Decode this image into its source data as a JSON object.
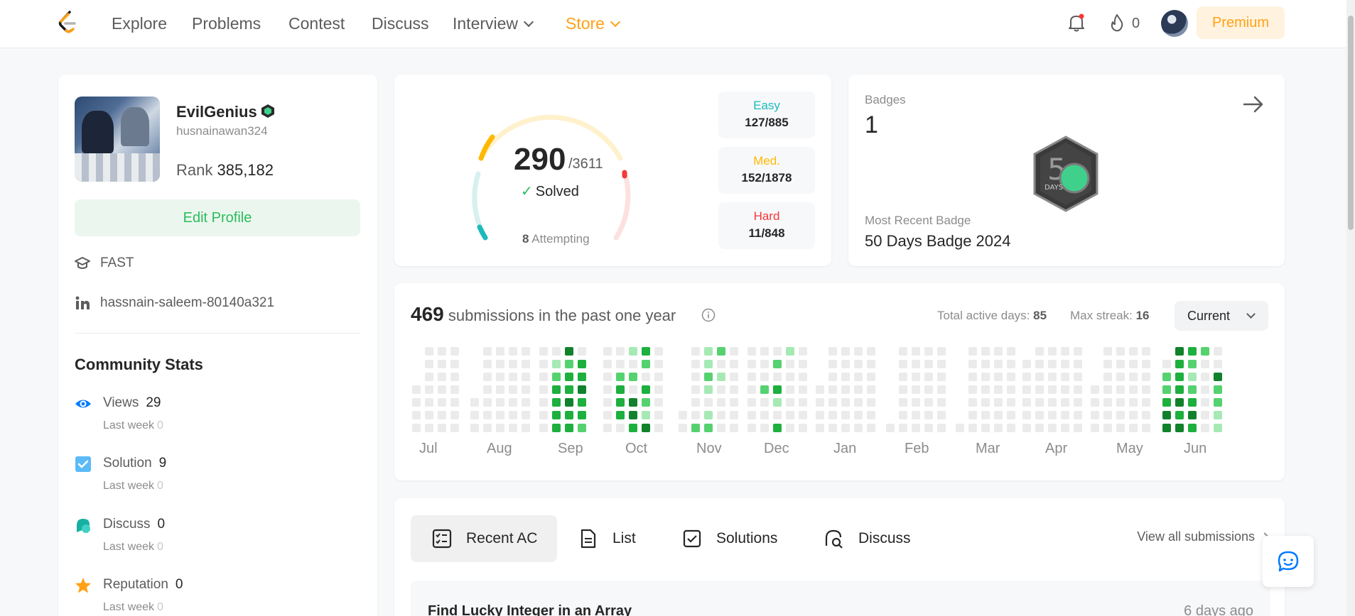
{
  "nav": {
    "items": [
      {
        "label": "Explore"
      },
      {
        "label": "Problems"
      },
      {
        "label": "Contest"
      },
      {
        "label": "Discuss"
      },
      {
        "label": "Interview"
      },
      {
        "label": "Store"
      }
    ],
    "streak": "0",
    "premium_label": "Premium",
    "store_color": "#ffa116"
  },
  "profile": {
    "display_name": "EvilGenius",
    "username": "husnainawan324",
    "rank_label": "Rank",
    "rank_value": "385,182",
    "edit_label": "Edit Profile",
    "school": "FAST",
    "linkedin": "hassnain-saleem-80140a321"
  },
  "community": {
    "title": "Community Stats",
    "stats": [
      {
        "label": "Views",
        "value": "29",
        "sub_label": "Last week",
        "sub_value": "0",
        "icon": "eye-icon"
      },
      {
        "label": "Solution",
        "value": "9",
        "sub_label": "Last week",
        "sub_value": "0",
        "icon": "checkbox-icon"
      },
      {
        "label": "Discuss",
        "value": "0",
        "sub_label": "Last week",
        "sub_value": "0",
        "icon": "chat-bubble-icon"
      },
      {
        "label": "Reputation",
        "value": "0",
        "sub_label": "Last week",
        "sub_value": "0",
        "icon": "star-icon"
      }
    ]
  },
  "solved": {
    "count": "290",
    "total": "/3611",
    "label": "Solved",
    "attempting_count": "8",
    "attempting_label": "Attempting",
    "easy": {
      "label": "Easy",
      "value": "127/885",
      "color": "#1cbaba"
    },
    "medium": {
      "label": "Med.",
      "value": "152/1878",
      "color": "#ffb800"
    },
    "hard": {
      "label": "Hard",
      "value": "11/848",
      "color": "#f63737"
    }
  },
  "badges": {
    "label": "Badges",
    "count": "1",
    "recent_label": "Most Recent Badge",
    "recent_name": "50 Days Badge 2024",
    "badge_text": "DAYS"
  },
  "submissions": {
    "count": "469",
    "label": "submissions in the past one year",
    "active_days_label": "Total active days:",
    "active_days": "85",
    "max_streak_label": "Max streak:",
    "max_streak": "16",
    "period": "Current",
    "months": [
      "Jul",
      "Aug",
      "Sep",
      "Oct",
      "Nov",
      "Dec",
      "Jan",
      "Feb",
      "Mar",
      "Apr",
      "May",
      "Jun"
    ],
    "heat_colors": [
      "#ebebeb",
      "#a6e9b5",
      "#55d26f",
      "#1db03e",
      "#12812c"
    ]
  },
  "recent": {
    "tabs": [
      {
        "label": "Recent AC",
        "icon": "checklist-icon"
      },
      {
        "label": "List",
        "icon": "document-icon"
      },
      {
        "label": "Solutions",
        "icon": "checked-box-icon"
      },
      {
        "label": "Discuss",
        "icon": "discuss-icon"
      }
    ],
    "view_all": "View all submissions",
    "items": [
      {
        "title": "Find Lucky Integer in an Array",
        "time": "6 days ago"
      }
    ]
  }
}
